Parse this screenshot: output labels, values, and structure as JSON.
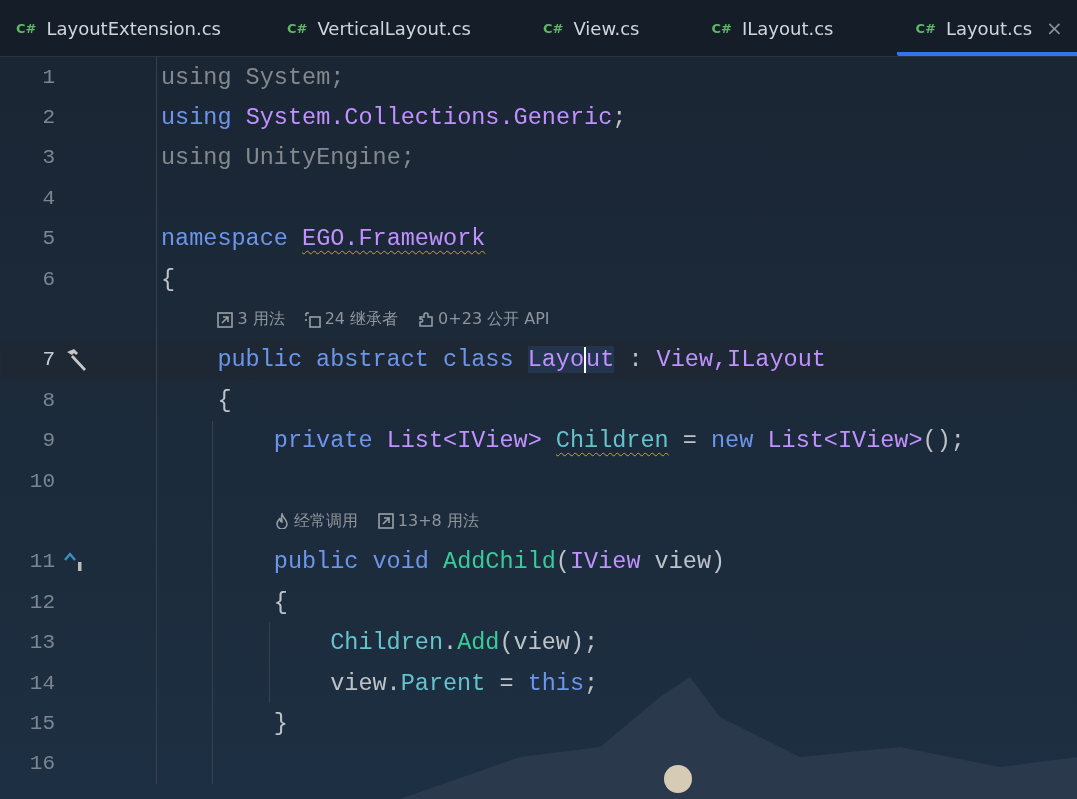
{
  "tabs": [
    {
      "icon": "C#",
      "label": "LayoutExtension.cs",
      "selected": false
    },
    {
      "icon": "C#",
      "label": "VerticalLayout.cs",
      "selected": false
    },
    {
      "icon": "C#",
      "label": "View.cs",
      "selected": false
    },
    {
      "icon": "C#",
      "label": "ILayout.cs",
      "selected": false
    },
    {
      "icon": "C#",
      "label": "Layout.cs",
      "selected": true,
      "close": "×"
    }
  ],
  "rows": [
    {
      "kind": "code",
      "number": "1",
      "tokens": [
        {
          "t": "using System;",
          "kind": "dim"
        }
      ]
    },
    {
      "kind": "code",
      "number": "2",
      "tokens": [
        {
          "t": "using ",
          "kind": "kw"
        },
        {
          "t": "System.Collections.Generic",
          "kind": "type"
        },
        {
          "t": ";",
          "kind": "plain"
        }
      ]
    },
    {
      "kind": "code",
      "number": "3",
      "tokens": [
        {
          "t": "using UnityEngine;",
          "kind": "dim"
        }
      ]
    },
    {
      "kind": "code",
      "number": "4"
    },
    {
      "kind": "code",
      "number": "5",
      "tokens": [
        {
          "t": "namespace ",
          "kind": "kw"
        },
        {
          "t": "EGO.Framework",
          "kind": "type",
          "warning": true
        }
      ]
    },
    {
      "kind": "code",
      "number": "6",
      "tokens": [
        {
          "t": "{",
          "kind": "plain"
        }
      ]
    },
    {
      "kind": "block",
      "children": [
        {
          "kind": "hints",
          "items": [
            {
              "kind": "usages",
              "text": "3 用法"
            },
            {
              "kind": "inheritors",
              "text": "24 继承者"
            },
            {
              "kind": "api",
              "text": "0+23 公开 API"
            }
          ]
        },
        {
          "kind": "code",
          "number": "7",
          "current": true,
          "marker": {
            "kind": "hammer"
          },
          "tokens": [
            {
              "t": "public abstract class ",
              "kind": "kw"
            },
            {
              "t": "Layo",
              "kind": "type",
              "highlight": true,
              "caret": true
            },
            {
              "t": "ut",
              "kind": "type",
              "highlight": true
            },
            {
              "t": " : ",
              "kind": "plain"
            },
            {
              "t": "View,ILayout",
              "kind": "type"
            }
          ]
        },
        {
          "kind": "code",
          "number": "8",
          "tokens": [
            {
              "t": "{",
              "kind": "plain"
            }
          ]
        },
        {
          "kind": "block",
          "children": [
            {
              "kind": "code",
              "number": "9",
              "tokens": [
                {
                  "t": "private ",
                  "kind": "kw"
                },
                {
                  "t": "List<IView> ",
                  "kind": "type"
                },
                {
                  "t": "Children",
                  "kind": "field",
                  "warning": true
                },
                {
                  "t": " = ",
                  "kind": "plain"
                },
                {
                  "t": "new ",
                  "kind": "kw"
                },
                {
                  "t": "List<IView>",
                  "kind": "type"
                },
                {
                  "t": "();",
                  "kind": "plain"
                }
              ]
            },
            {
              "kind": "code",
              "number": "10"
            },
            {
              "kind": "hints",
              "items": [
                {
                  "kind": "flame",
                  "text": "经常调用"
                },
                {
                  "kind": "usages",
                  "text": "13+8 用法"
                }
              ]
            },
            {
              "kind": "code",
              "number": "11",
              "marker": {
                "kind": "override"
              },
              "tokens": [
                {
                  "t": "public void ",
                  "kind": "kw"
                },
                {
                  "t": "AddChild",
                  "kind": "method"
                },
                {
                  "t": "(",
                  "kind": "plain"
                },
                {
                  "t": "IView",
                  "kind": "type"
                },
                {
                  "t": " view)",
                  "kind": "plain"
                }
              ]
            },
            {
              "kind": "code",
              "number": "12",
              "tokens": [
                {
                  "t": "{",
                  "kind": "plain"
                }
              ]
            },
            {
              "kind": "block",
              "children": [
                {
                  "kind": "code",
                  "number": "13",
                  "tokens": [
                    {
                      "t": "Children",
                      "kind": "field"
                    },
                    {
                      "t": ".",
                      "kind": "plain"
                    },
                    {
                      "t": "Add",
                      "kind": "method"
                    },
                    {
                      "t": "(view);",
                      "kind": "plain"
                    }
                  ]
                },
                {
                  "kind": "code",
                  "number": "14",
                  "tokens": [
                    {
                      "t": "view.",
                      "kind": "plain"
                    },
                    {
                      "t": "Parent",
                      "kind": "field"
                    },
                    {
                      "t": " = ",
                      "kind": "plain"
                    },
                    {
                      "t": "this",
                      "kind": "kw"
                    },
                    {
                      "t": ";",
                      "kind": "plain"
                    }
                  ]
                }
              ]
            },
            {
              "kind": "code",
              "number": "15",
              "tokens": [
                {
                  "t": "}",
                  "kind": "plain"
                }
              ]
            },
            {
              "kind": "code",
              "number": "16"
            }
          ]
        }
      ]
    }
  ]
}
